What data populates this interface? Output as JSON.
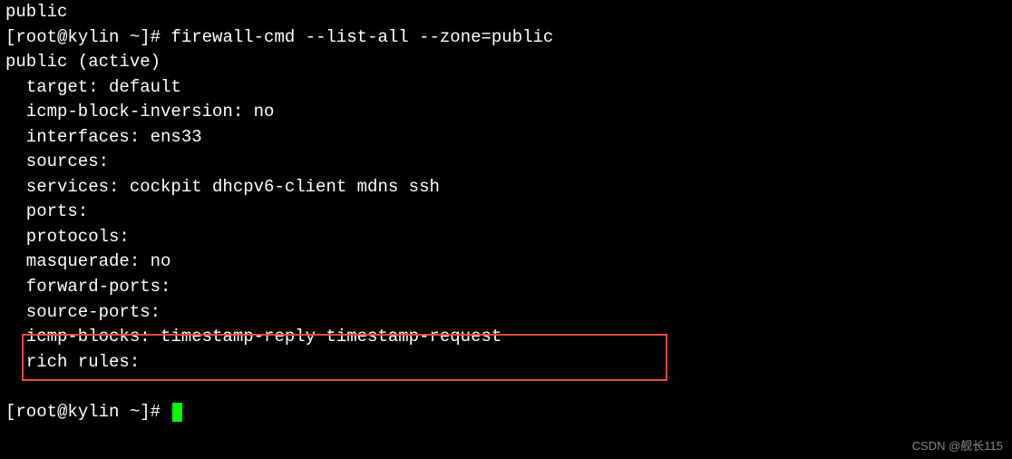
{
  "line_top": "public",
  "prompt": {
    "user_host": "[root@kylin ~]# ",
    "command": "firewall-cmd --list-all --zone=public"
  },
  "output": {
    "zone_line": "public (active)",
    "target": "target: default",
    "icmp_inv": "icmp-block-inversion: no",
    "interfaces": "interfaces: ens33",
    "sources": "sources:",
    "services": "services: cockpit dhcpv6-client mdns ssh",
    "ports": "ports:",
    "protocols": "protocols:",
    "masquerade": "masquerade: no",
    "forward_ports": "forward-ports:",
    "source_ports": "source-ports:",
    "icmp_blocks": "icmp-blocks: timestamp-reply timestamp-request",
    "rich_rules": "rich rules:"
  },
  "prompt2": "[root@kylin ~]# ",
  "watermark": "CSDN @舰长115"
}
